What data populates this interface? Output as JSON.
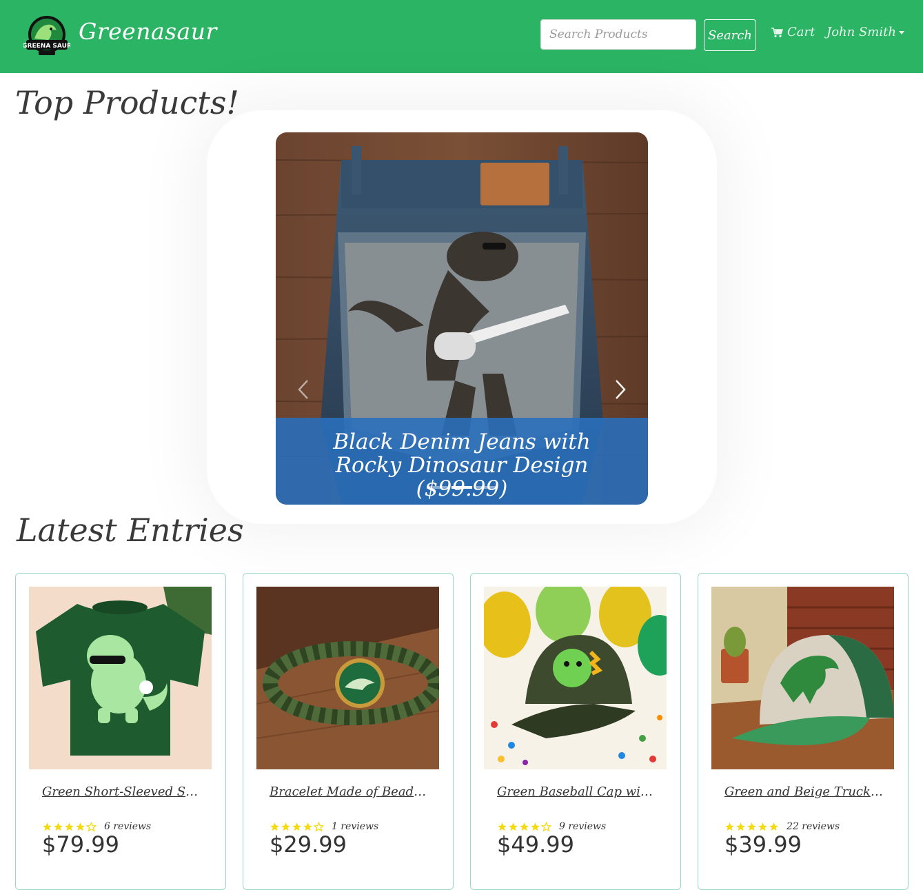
{
  "brand": {
    "name": "Greenasaur",
    "logo_text": "GREENA SAUR"
  },
  "search": {
    "placeholder": "Search Products",
    "button_label": "Search"
  },
  "nav": {
    "cart_label": "Cart",
    "user_name": "John Smith"
  },
  "sections": {
    "top_products": "Top Products!",
    "latest_entries": "Latest Entries"
  },
  "carousel": {
    "caption": "Black Denim Jeans with Rocky Dinosaur Design ($99.99)",
    "active_index": 1,
    "slide_count": 3
  },
  "products": [
    {
      "title": "Green Short-Sleeved Shirt ...",
      "rating": 4,
      "reviews": "6 reviews",
      "price": "$79.99"
    },
    {
      "title": "Bracelet Made of Beads wi...",
      "rating": 4,
      "reviews": "1 reviews",
      "price": "$29.99"
    },
    {
      "title": "Green Baseball Cap with ...",
      "rating": 4,
      "reviews": "9 reviews",
      "price": "$49.99"
    },
    {
      "title": "Green and Beige Trucker ...",
      "rating": 5,
      "reviews": "22 reviews",
      "price": "$39.99"
    }
  ],
  "colors": {
    "primary": "#2bb463",
    "caption_bg": "#2970bd",
    "star": "#f5d90a",
    "card_border": "#9ad8c6"
  }
}
